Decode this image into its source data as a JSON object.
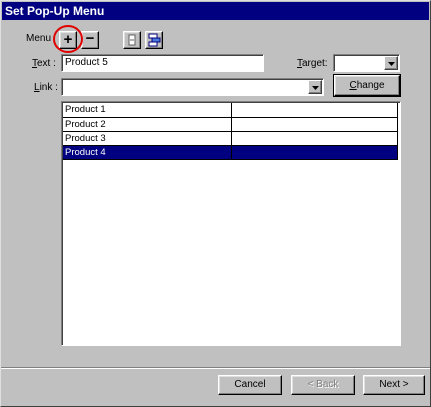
{
  "window": {
    "title": "Set Pop-Up Menu"
  },
  "toolbar": {
    "menu_label": "Menu",
    "add_symbol": "+",
    "remove_symbol": "−"
  },
  "form": {
    "text_label_accel": "T",
    "text_label_rest": "ext :",
    "text_value": "Product 5",
    "target_label_accel": "T",
    "target_label_rest": "arget:",
    "target_value": "",
    "link_label_accel": "L",
    "link_label_rest": "ink :",
    "link_value": "",
    "change_label_accel": "C",
    "change_label_rest": "hange"
  },
  "menu_table": {
    "rows": [
      {
        "text": "Product 1",
        "link": "",
        "selected": false
      },
      {
        "text": "Product 2",
        "link": "",
        "selected": false
      },
      {
        "text": "Product 3",
        "link": "",
        "selected": false
      },
      {
        "text": "Product 4",
        "link": "",
        "selected": true
      }
    ]
  },
  "footer": {
    "cancel_label": "Cancel",
    "back_label": "< Back",
    "next_label": "Next >"
  },
  "colors": {
    "title_bar": "#000080",
    "selection": "#000080",
    "highlight_circle": "#e00000",
    "face": "#c0c0c0"
  }
}
